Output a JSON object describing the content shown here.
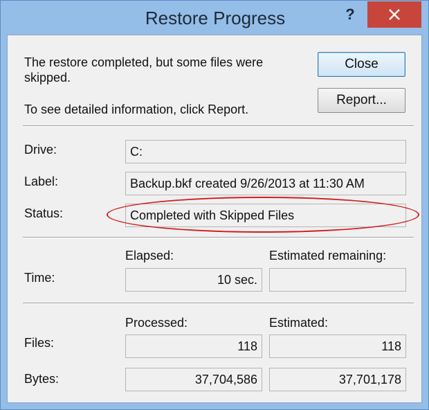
{
  "window": {
    "title": "Restore Progress",
    "help_label": "?",
    "close_icon": "close-icon"
  },
  "message": {
    "line1": "The restore completed, but some files were",
    "line2": "skipped.",
    "line3": "To see detailed information, click Report."
  },
  "buttons": {
    "close_label": "Close",
    "report_label": "Report..."
  },
  "info": {
    "drive_label": "Drive:",
    "drive_value": "C:",
    "label_label": "Label:",
    "label_value": "Backup.bkf created 9/26/2013 at 11:30 AM",
    "status_label": "Status:",
    "status_value": "Completed with Skipped Files"
  },
  "time": {
    "row_label": "Time:",
    "elapsed_header": "Elapsed:",
    "remaining_header": "Estimated remaining:",
    "elapsed_value": "10 sec.",
    "remaining_value": ""
  },
  "counts": {
    "processed_header": "Processed:",
    "estimated_header": "Estimated:",
    "files_label": "Files:",
    "files_processed": "118",
    "files_estimated": "118",
    "bytes_label": "Bytes:",
    "bytes_processed": "37,704,586",
    "bytes_estimated": "37,701,178"
  },
  "colors": {
    "frame": "#94bde8",
    "close_button": "#c7453b",
    "annotation": "#d21e1e"
  }
}
